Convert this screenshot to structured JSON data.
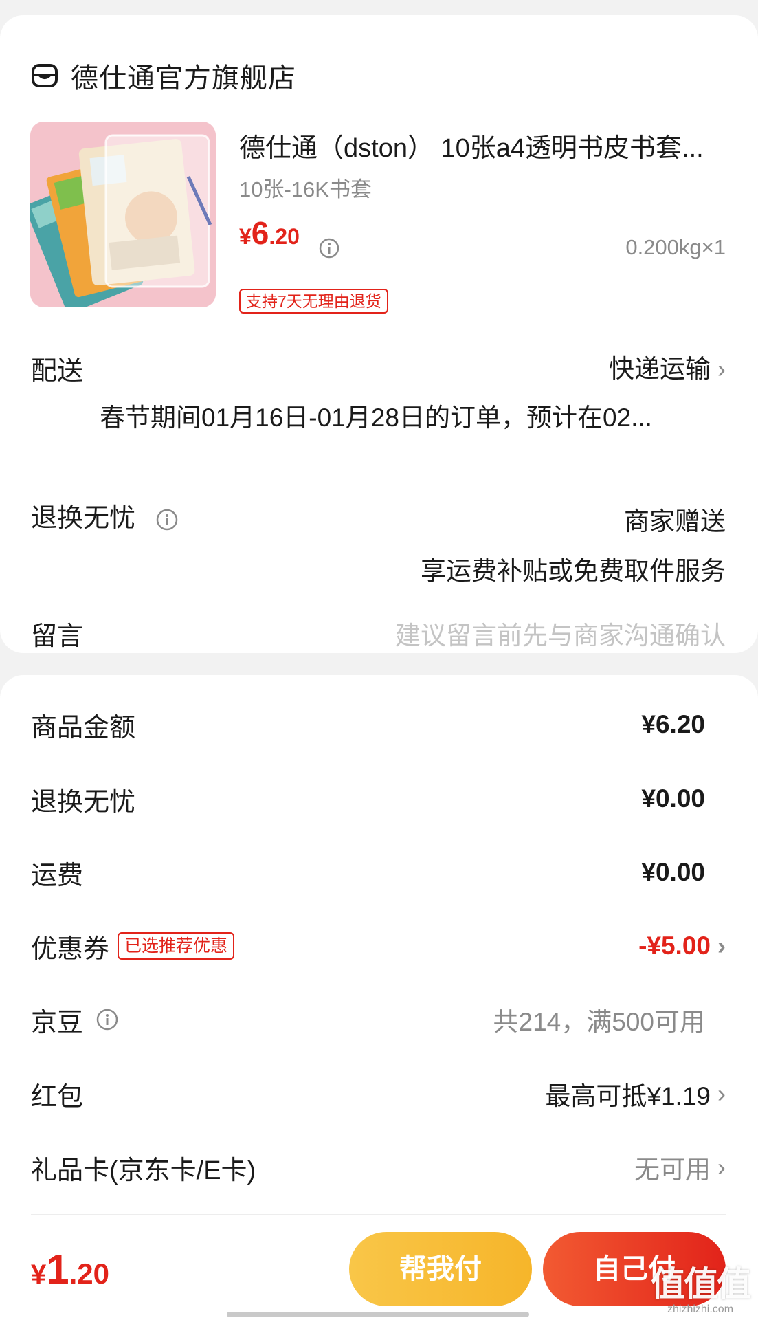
{
  "store": {
    "icon": "store-icon",
    "name": "德仕通官方旗舰店"
  },
  "product": {
    "title": "德仕通（dston） 10张a4透明书皮书套...",
    "spec": "10张-16K书套",
    "price_currency": "¥",
    "price_int": "6",
    "price_dec": ".20",
    "weight_qty": "0.200kg×1",
    "return_badge": "支持7天无理由退货"
  },
  "delivery": {
    "label": "配送",
    "method": "快递运输",
    "note": "春节期间01月16日-01月28日的订单，预计在02..."
  },
  "return_worry": {
    "label": "退换无忧",
    "value": "商家赠送",
    "desc": "享运费补贴或免费取件服务"
  },
  "message": {
    "label": "留言",
    "placeholder": "建议留言前先与商家沟通确认"
  },
  "fees": {
    "goods_amount": {
      "label": "商品金额",
      "value": "¥6.20"
    },
    "return_worry": {
      "label": "退换无忧",
      "value": "¥0.00"
    },
    "shipping": {
      "label": "运费",
      "value": "¥0.00"
    },
    "coupon": {
      "label": "优惠券",
      "tag": "已选推荐优惠",
      "value": "-¥5.00"
    },
    "jingdou": {
      "label": "京豆",
      "value": "共214，满500可用"
    },
    "red_packet": {
      "label": "红包",
      "value": "最高可抵¥1.19"
    },
    "gift_card": {
      "label": "礼品卡(京东卡/E卡)",
      "value": "无可用"
    }
  },
  "footer": {
    "total_currency": "¥",
    "total_int": "1",
    "total_dec": ".20",
    "help_pay": "帮我付",
    "self_pay": "自己付",
    "watermark_main": "值值值",
    "watermark_sub": "zhizhizhi.com"
  },
  "colors": {
    "accent_red": "#e2231a",
    "help_yellow": "#f6b52a",
    "text_grey": "#8a8a8a"
  }
}
